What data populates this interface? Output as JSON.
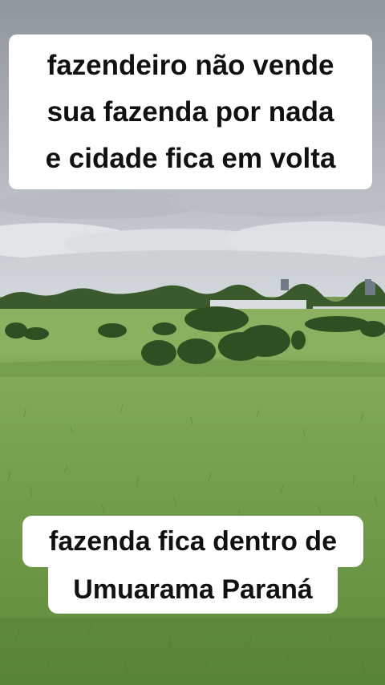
{
  "captions": {
    "top": [
      "fazendeiro não vende",
      "sua fazenda por nada",
      "e cidade fica em volta"
    ],
    "bottom": [
      "fazenda fica dentro de",
      "Umuarama Paraná"
    ]
  },
  "colors": {
    "sky_top": "#9ea4aa",
    "sky_bottom": "#c9cfd5",
    "grass_light": "#8fb064",
    "grass_dark": "#5f8a3a",
    "tree": "#2f4f22",
    "caption_bg": "#ffffff",
    "caption_text": "#111111"
  }
}
